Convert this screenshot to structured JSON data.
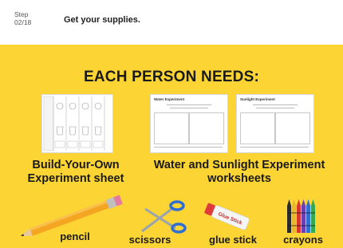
{
  "header": {
    "step_label": "Step",
    "step_value": "02/18",
    "instruction": "Get your supplies."
  },
  "panel": {
    "title": "EACH PERSON NEEDS:",
    "sheet_label": "Build-Your-Own Experiment sheet",
    "worksheets_label": "Water and Sunlight Experiment worksheets",
    "worksheet_water_title": "Water Experiment",
    "worksheet_sun_title": "Sunlight Experiment",
    "glue_text": "Glue Stick"
  },
  "supplies": {
    "pencil": "pencil",
    "scissors": "scissors",
    "glue": "glue stick",
    "crayons": "crayons"
  },
  "colors": {
    "panel": "#fcd535",
    "text": "#1a1a1a"
  }
}
